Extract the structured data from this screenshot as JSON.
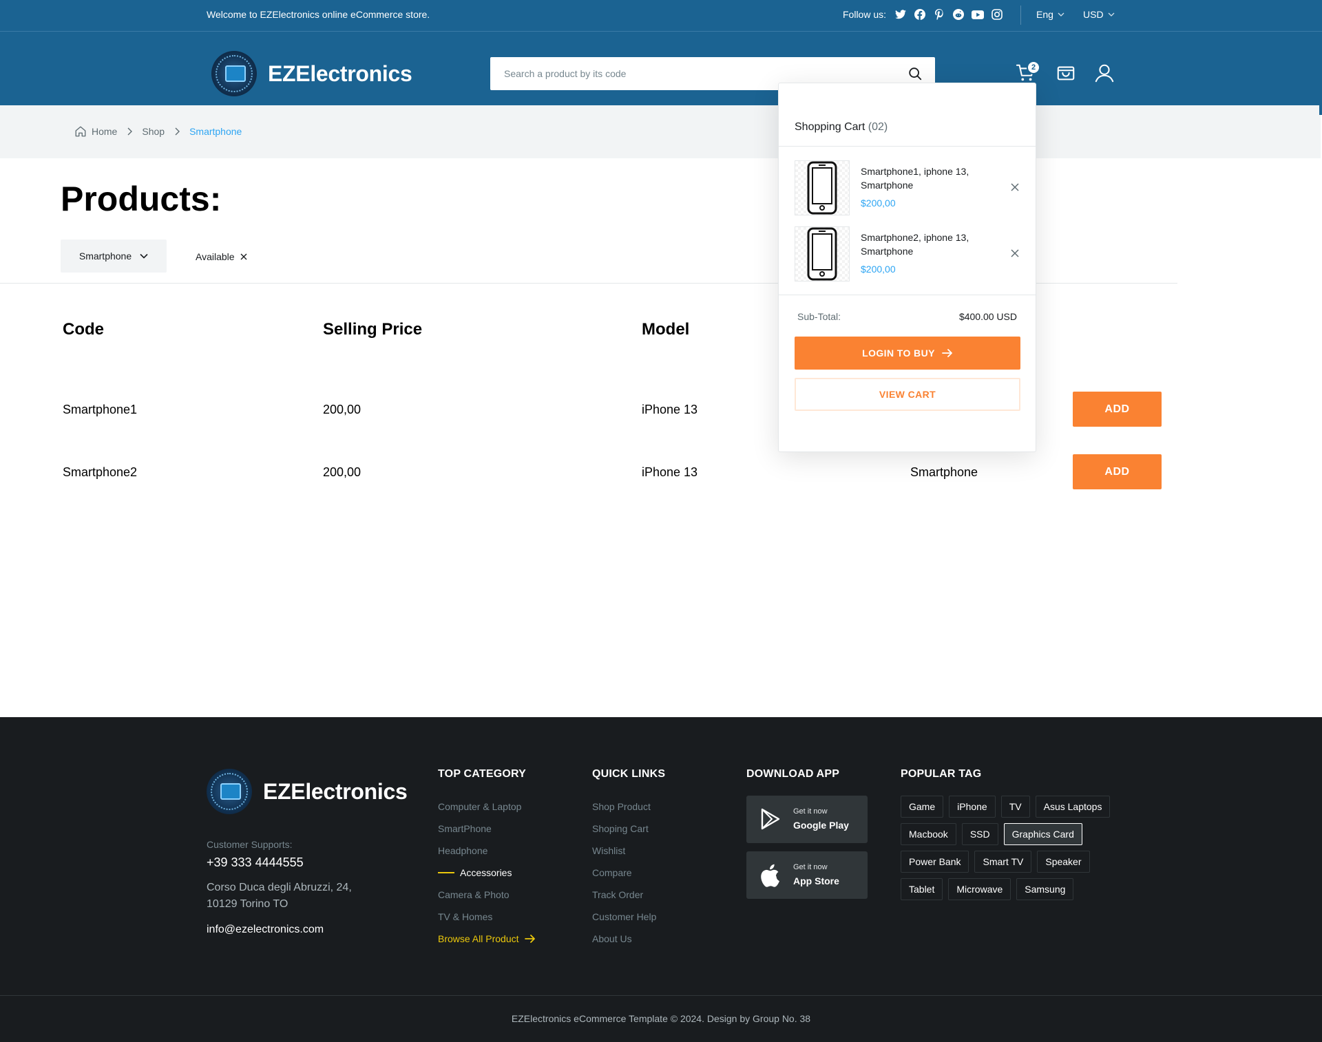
{
  "topbar": {
    "welcome": "Welcome to EZElectronics online eCommerce store.",
    "follow_label": "Follow us:",
    "socials": [
      "twitter-icon",
      "facebook-icon",
      "pinterest-icon",
      "reddit-icon",
      "youtube-icon",
      "instagram-icon"
    ],
    "language": "Eng",
    "currency": "USD"
  },
  "header": {
    "brand": "EZElectronics",
    "logo_mark": "EZ",
    "search_placeholder": "Search a product by its code",
    "cart_count": "2"
  },
  "breadcrumb": {
    "home": "Home",
    "shop": "Shop",
    "current": "Smartphone"
  },
  "products": {
    "title": "Products:",
    "filter": "Smartphone",
    "chip": "Available",
    "columns": [
      "Code",
      "Selling Price",
      "Model"
    ],
    "rows": [
      {
        "code": "Smartphone1",
        "price": "200,00",
        "model": "iPhone 13",
        "category": "",
        "action": "ADD"
      },
      {
        "code": "Smartphone2",
        "price": "200,00",
        "model": "iPhone 13",
        "category": "Smartphone",
        "action": "ADD"
      }
    ]
  },
  "cart": {
    "title": "Shopping Cart",
    "count": "(02)",
    "items": [
      {
        "name": "Smartphone1, iphone 13, Smartphone",
        "price": "$200,00"
      },
      {
        "name": "Smartphone2, iphone 13, Smartphone",
        "price": "$200,00"
      }
    ],
    "subtotal_label": "Sub-Total:",
    "subtotal_value": "$400.00 USD",
    "login_label": "LOGIN TO BUY",
    "view_label": "VIEW CART"
  },
  "footer": {
    "brand": "EZElectronics",
    "support_label": "Customer Supports:",
    "phone": "+39 333 4444555",
    "address": "Corso Duca degli Abruzzi, 24, 10129 Torino TO",
    "email": "info@ezelectronics.com",
    "top_category": {
      "heading": "TOP CATEGORY",
      "items": [
        "Computer & Laptop",
        "SmartPhone",
        "Headphone",
        "Accessories",
        "Camera & Photo",
        "TV & Homes"
      ],
      "browse": "Browse All Product"
    },
    "quick_links": {
      "heading": "QUICK LINKS",
      "items": [
        "Shop Product",
        "Shoping Cart",
        "Wishlist",
        "Compare",
        "Track Order",
        "Customer Help",
        "About Us"
      ]
    },
    "download": {
      "heading": "DOWNLOAD APP",
      "google_small": "Get it now",
      "google_big": "Google Play",
      "apple_small": "Get it now",
      "apple_big": "App Store"
    },
    "popular_tag": {
      "heading": "POPULAR TAG",
      "tags": [
        "Game",
        "iPhone",
        "TV",
        "Asus Laptops",
        "Macbook",
        "SSD",
        "Graphics Card",
        "Power Bank",
        "Smart TV",
        "Speaker",
        "Tablet",
        "Microwave",
        "Samsung"
      ]
    },
    "copyright": "EZElectronics eCommerce Template © 2024. Design by Group No. 38"
  },
  "colors": {
    "primary": "#1b6392",
    "accent": "#fa8232",
    "link": "#2da5f3",
    "footer_bg": "#191c1f",
    "highlight": "#ebc80c"
  }
}
